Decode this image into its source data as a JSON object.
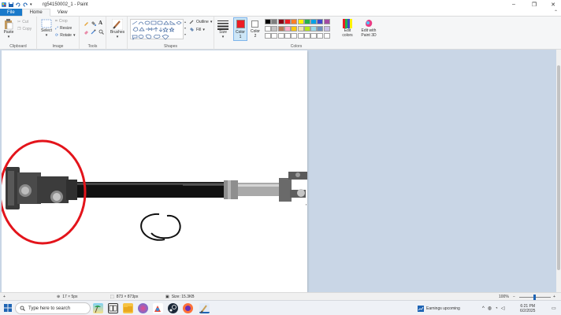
{
  "window": {
    "title": "rg54150002_1 - Paint",
    "minimize": "–",
    "maximize": "❐",
    "close": "✕"
  },
  "tabs": [
    "File",
    "Home",
    "View"
  ],
  "ribbon": {
    "clipboard": {
      "paste": "Paste",
      "cut": "Cut",
      "copy": "Copy",
      "label": "Clipboard"
    },
    "image": {
      "select": "Select",
      "crop": "Crop",
      "resize": "Resize",
      "rotate": "Rotate",
      "label": "Image"
    },
    "tools": {
      "label": "Tools"
    },
    "brushes": {
      "label": "Brushes"
    },
    "shapes": {
      "outline": "Outline",
      "fill": "Fill",
      "label": "Shapes"
    },
    "size": {
      "label": "Size"
    },
    "color1": {
      "label": "Color 1"
    },
    "color2": {
      "label": "Color 2"
    },
    "colors": {
      "label": "Colors",
      "edit_colors": "Edit colors",
      "edit_paint3d": "Edit with Paint 3D",
      "row1": [
        "#000000",
        "#7f7f7f",
        "#880015",
        "#ed1c24",
        "#ff7f27",
        "#fff200",
        "#22b14c",
        "#00a2e8",
        "#3f48cc",
        "#a349a4"
      ],
      "row2": [
        "#ffffff",
        "#c3c3c3",
        "#b97a57",
        "#ffaec9",
        "#ffc90e",
        "#efe4b0",
        "#b5e61d",
        "#99d9ea",
        "#7092be",
        "#c8bfe7"
      ],
      "active_color1": "#ed1c24",
      "active_color2": "#ffffff"
    }
  },
  "statusbar": {
    "cursor": "17 × 5px",
    "selection": "873 × 873px",
    "size": "Size: 15.3KB",
    "zoom": "100%"
  },
  "taskbar": {
    "search_placeholder": "Type here to search",
    "news": "Earnings upcoming",
    "time": "6:21 PM",
    "date": "6/2/2025"
  }
}
